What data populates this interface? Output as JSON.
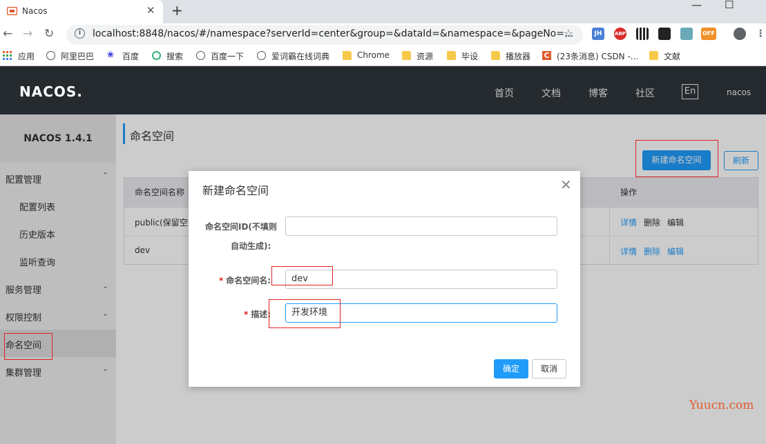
{
  "browser": {
    "tab_title": "Nacos",
    "tab_close": "✕",
    "new_tab": "+",
    "win_minimize": "—",
    "win_maximize": "☐",
    "url": "localhost:8848/nacos/#/namespace?serverId=center&group=&dataId=&namespace=&pageNo=...",
    "bookmarks": [
      "应用",
      "阿里巴巴",
      "百度",
      "搜索",
      "百度一下",
      "爱词霸在线词典",
      "Chrome",
      "资源",
      "毕设",
      "播放器",
      "(23条消息) CSDN -...",
      "文献"
    ],
    "extensions": [
      "JH",
      "ABP",
      "OFF"
    ]
  },
  "header": {
    "logo": "NACOS.",
    "nav": [
      "首页",
      "文档",
      "博客",
      "社区"
    ],
    "lang": "En",
    "user": "nacos"
  },
  "sidebar": {
    "title": "NACOS 1.4.1",
    "items": [
      {
        "label": "配置管理",
        "chev": "⌃"
      },
      {
        "label": "配置列表"
      },
      {
        "label": "历史版本"
      },
      {
        "label": "监听查询"
      },
      {
        "label": "服务管理",
        "chev": "⌄"
      },
      {
        "label": "权限控制",
        "chev": "⌄"
      },
      {
        "label": "命名空间"
      },
      {
        "label": "集群管理",
        "chev": "⌄"
      }
    ]
  },
  "main": {
    "title": "命名空间",
    "new_button": "新建命名空间",
    "refresh_button": "刷新",
    "table": {
      "headers": [
        "命名空间名称",
        "操作"
      ],
      "rows": [
        {
          "name": "public(保留空间)",
          "ops": [
            "详情",
            "删除",
            "编辑"
          ]
        },
        {
          "name": "dev",
          "ops": [
            "详情",
            "删除",
            "编辑"
          ]
        }
      ]
    }
  },
  "dialog": {
    "title": "新建命名空间",
    "close": "✕",
    "id_label_line1": "命名空间ID(不填则",
    "id_label_line2": "自动生成):",
    "id_value": "",
    "name_label": "命名空间名:",
    "name_value": "dev",
    "desc_label": "描述:",
    "desc_value": "开发环境",
    "required_mark": "*",
    "ok": "确定",
    "cancel": "取消"
  },
  "watermark": "Yuucn.com",
  "colors": {
    "primary": "#209bfa",
    "header_bg": "#252a2f",
    "annotation": "#e02020"
  }
}
